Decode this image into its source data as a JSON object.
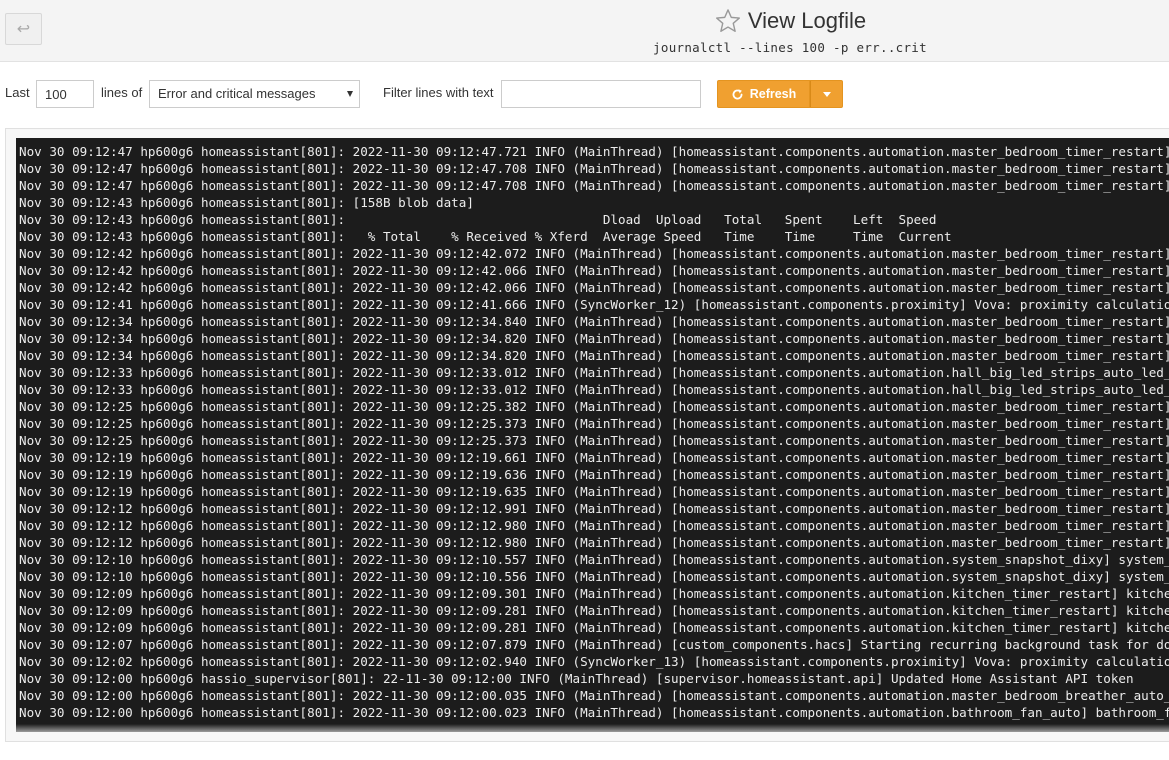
{
  "header": {
    "back_icon": "return-arrow",
    "title": "View Logfile",
    "subtitle": "journalctl --lines 100 -p err..crit",
    "star_icon": "star-outline"
  },
  "controls": {
    "last_label": "Last",
    "lines_value": "100",
    "lines_of_label": "lines of",
    "log_type_selected": "Error and critical messages",
    "filter_label": "Filter lines with text",
    "filter_value": "",
    "refresh_label": "Refresh",
    "accent_color": "#f0a030"
  },
  "log": {
    "lines": [
      "Nov 30 09:12:47 hp600g6 homeassistant[801]: 2022-11-30 09:12:47.721 INFO (MainThread) [homeassistant.components.automation.master_bedroom_timer_restart] master_",
      "Nov 30 09:12:47 hp600g6 homeassistant[801]: 2022-11-30 09:12:47.708 INFO (MainThread) [homeassistant.components.automation.master_bedroom_timer_restart] master_",
      "Nov 30 09:12:47 hp600g6 homeassistant[801]: 2022-11-30 09:12:47.708 INFO (MainThread) [homeassistant.components.automation.master_bedroom_timer_restart] master_",
      "Nov 30 09:12:43 hp600g6 homeassistant[801]: [158B blob data]",
      "Nov 30 09:12:43 hp600g6 homeassistant[801]:                                  Dload  Upload   Total   Spent    Left  Speed",
      "Nov 30 09:12:43 hp600g6 homeassistant[801]:   % Total    % Received % Xferd  Average Speed   Time    Time     Time  Current",
      "Nov 30 09:12:42 hp600g6 homeassistant[801]: 2022-11-30 09:12:42.072 INFO (MainThread) [homeassistant.components.automation.master_bedroom_timer_restart] master_",
      "Nov 30 09:12:42 hp600g6 homeassistant[801]: 2022-11-30 09:12:42.066 INFO (MainThread) [homeassistant.components.automation.master_bedroom_timer_restart] master_",
      "Nov 30 09:12:42 hp600g6 homeassistant[801]: 2022-11-30 09:12:42.066 INFO (MainThread) [homeassistant.components.automation.master_bedroom_timer_restart] master_",
      "Nov 30 09:12:41 hp600g6 homeassistant[801]: 2022-11-30 09:12:41.666 INFO (SyncWorker_12) [homeassistant.components.proximity] Vova: proximity calculation comple",
      "Nov 30 09:12:34 hp600g6 homeassistant[801]: 2022-11-30 09:12:34.840 INFO (MainThread) [homeassistant.components.automation.master_bedroom_timer_restart] master_",
      "Nov 30 09:12:34 hp600g6 homeassistant[801]: 2022-11-30 09:12:34.820 INFO (MainThread) [homeassistant.components.automation.master_bedroom_timer_restart] master_",
      "Nov 30 09:12:34 hp600g6 homeassistant[801]: 2022-11-30 09:12:34.820 INFO (MainThread) [homeassistant.components.automation.master_bedroom_timer_restart] master_",
      "Nov 30 09:12:33 hp600g6 homeassistant[801]: 2022-11-30 09:12:33.012 INFO (MainThread) [homeassistant.components.automation.hall_big_led_strips_auto_led_off] hal",
      "Nov 30 09:12:33 hp600g6 homeassistant[801]: 2022-11-30 09:12:33.012 INFO (MainThread) [homeassistant.components.automation.hall_big_led_strips_auto_led_off] hal",
      "Nov 30 09:12:25 hp600g6 homeassistant[801]: 2022-11-30 09:12:25.382 INFO (MainThread) [homeassistant.components.automation.master_bedroom_timer_restart] master_",
      "Nov 30 09:12:25 hp600g6 homeassistant[801]: 2022-11-30 09:12:25.373 INFO (MainThread) [homeassistant.components.automation.master_bedroom_timer_restart] master_",
      "Nov 30 09:12:25 hp600g6 homeassistant[801]: 2022-11-30 09:12:25.373 INFO (MainThread) [homeassistant.components.automation.master_bedroom_timer_restart] master_",
      "Nov 30 09:12:19 hp600g6 homeassistant[801]: 2022-11-30 09:12:19.661 INFO (MainThread) [homeassistant.components.automation.master_bedroom_timer_restart] master_",
      "Nov 30 09:12:19 hp600g6 homeassistant[801]: 2022-11-30 09:12:19.636 INFO (MainThread) [homeassistant.components.automation.master_bedroom_timer_restart] master_",
      "Nov 30 09:12:19 hp600g6 homeassistant[801]: 2022-11-30 09:12:19.635 INFO (MainThread) [homeassistant.components.automation.master_bedroom_timer_restart] master_",
      "Nov 30 09:12:12 hp600g6 homeassistant[801]: 2022-11-30 09:12:12.991 INFO (MainThread) [homeassistant.components.automation.master_bedroom_timer_restart] master_",
      "Nov 30 09:12:12 hp600g6 homeassistant[801]: 2022-11-30 09:12:12.980 INFO (MainThread) [homeassistant.components.automation.master_bedroom_timer_restart] master_",
      "Nov 30 09:12:12 hp600g6 homeassistant[801]: 2022-11-30 09:12:12.980 INFO (MainThread) [homeassistant.components.automation.master_bedroom_timer_restart] master_",
      "Nov 30 09:12:10 hp600g6 homeassistant[801]: 2022-11-30 09:12:10.557 INFO (MainThread) [homeassistant.components.automation.system_snapshot_dixy] system_snapshot",
      "Nov 30 09:12:10 hp600g6 homeassistant[801]: 2022-11-30 09:12:10.556 INFO (MainThread) [homeassistant.components.automation.system_snapshot_dixy] system_snapshot",
      "Nov 30 09:12:09 hp600g6 homeassistant[801]: 2022-11-30 09:12:09.301 INFO (MainThread) [homeassistant.components.automation.kitchen_timer_restart] kitchen_timer_",
      "Nov 30 09:12:09 hp600g6 homeassistant[801]: 2022-11-30 09:12:09.281 INFO (MainThread) [homeassistant.components.automation.kitchen_timer_restart] kitchen_timer_",
      "Nov 30 09:12:09 hp600g6 homeassistant[801]: 2022-11-30 09:12:09.281 INFO (MainThread) [homeassistant.components.automation.kitchen_timer_restart] kitchen_timer_",
      "Nov 30 09:12:07 hp600g6 homeassistant[801]: 2022-11-30 09:12:07.879 INFO (MainThread) [custom_components.hacs] Starting recurring background task for downloaded",
      "Nov 30 09:12:02 hp600g6 homeassistant[801]: 2022-11-30 09:12:02.940 INFO (SyncWorker_13) [homeassistant.components.proximity] Vova: proximity calculation comple",
      "Nov 30 09:12:00 hp600g6 hassio_supervisor[801]: 22-11-30 09:12:00 INFO (MainThread) [supervisor.homeassistant.api] Updated Home Assistant API token",
      "Nov 30 09:12:00 hp600g6 homeassistant[801]: 2022-11-30 09:12:00.035 INFO (MainThread) [homeassistant.components.automation.master_bedroom_breather_auto_co2] mas",
      "Nov 30 09:12:00 hp600g6 homeassistant[801]: 2022-11-30 09:12:00.023 INFO (MainThread) [homeassistant.components.automation.bathroom_fan_auto] bathroom_fan_auto:"
    ]
  }
}
